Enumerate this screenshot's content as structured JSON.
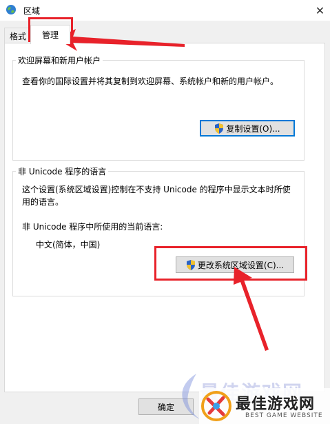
{
  "window": {
    "title": "区域"
  },
  "tabs": [
    {
      "label": "格式"
    },
    {
      "label": "管理"
    }
  ],
  "welcome_group": {
    "title": "欢迎屏幕和新用户帐户",
    "description": "查看你的国际设置并将其复制到欢迎屏幕、系统帐户和新的用户帐户。",
    "copy_button": "复制设置(O)..."
  },
  "unicode_group": {
    "title": "非 Unicode 程序的语言",
    "description": "这个设置(系统区域设置)控制在不支持 Unicode 的程序中显示文本时所使用的语言。",
    "current_label": "非 Unicode 程序中所使用的当前语言:",
    "current_value": "中文(简体，中国)",
    "change_button": "更改系统区域设置(C)..."
  },
  "footer": {
    "ok_button": "确定"
  },
  "watermark": {
    "title": "最佳游戏网",
    "subtitle": "BEST GAME WEBSITE",
    "text": "最佳游戏网"
  },
  "colors": {
    "annotation": "#e8222a",
    "accent": "#0078d7"
  }
}
